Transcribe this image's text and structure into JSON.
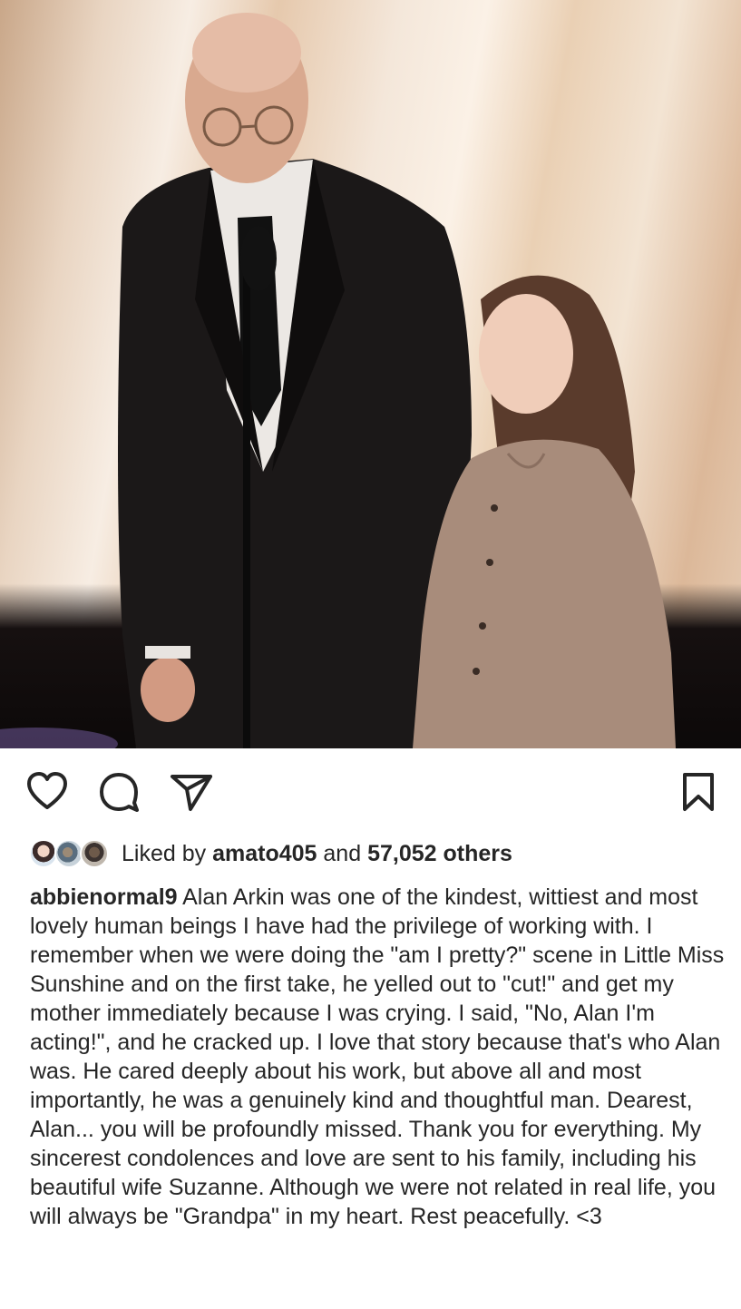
{
  "post": {
    "photo_alt_icon": "photo-of-man-in-suit-and-girl-on-stage",
    "actions": {
      "like_icon": "heart-outline-icon",
      "comment_icon": "speech-bubble-icon",
      "share_icon": "paper-plane-icon",
      "save_icon": "bookmark-outline-icon"
    },
    "likes": {
      "prefix": "Liked by",
      "user": "amato405",
      "conjunction": "and",
      "others": "57,052 others"
    },
    "caption": {
      "username": "abbienormal9",
      "text": " Alan Arkin was one of the kindest, wittiest and most lovely human beings I have had the privilege of working with. I remember when we were doing the \"am I pretty?\" scene in Little Miss Sunshine and on the first take, he yelled out to \"cut!\" and get my mother immediately because I was crying. I said, \"No, Alan I'm acting!\", and he cracked up. I love that story because that's who Alan was. He cared deeply about his work, but above all and most importantly, he was a genuinely kind and thoughtful man. Dearest, Alan... you will be profoundly missed. Thank you for everything. My sincerest condolences and love are sent to his family, including his beautiful wife Suzanne. Although we were not related in real life, you will always be \"Grandpa\" in my heart. Rest peacefully. <3"
    },
    "colors": {
      "text": "#262626",
      "background": "#ffffff"
    }
  }
}
